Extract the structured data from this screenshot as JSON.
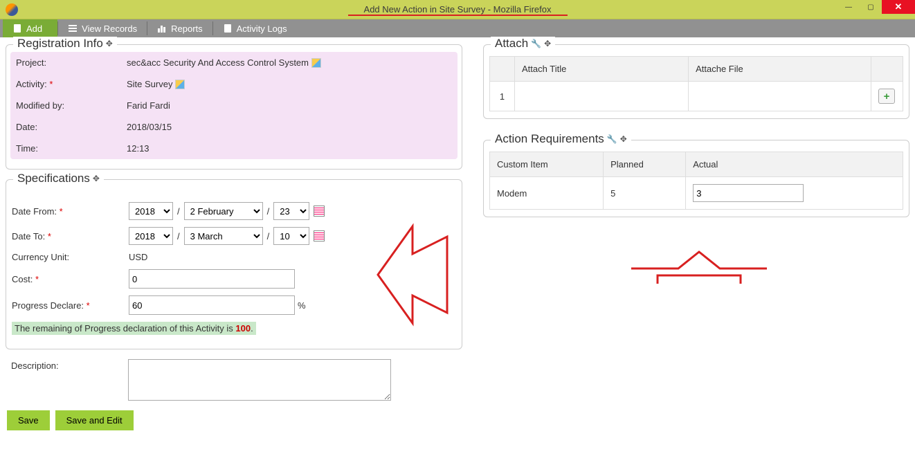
{
  "window": {
    "title": "Add New Action in Site Survey - Mozilla Firefox"
  },
  "toolbar": {
    "add": "Add",
    "view_records": "View Records",
    "reports": "Reports",
    "activity_logs": "Activity Logs"
  },
  "panels": {
    "registration": "Registration Info",
    "specifications": "Specifications",
    "attach": "Attach",
    "requirements": "Action Requirements"
  },
  "registration": {
    "project_label": "Project:",
    "project_value": "sec&acc Security And Access Control System",
    "activity_label": "Activity:",
    "activity_value": "Site Survey",
    "modified_label": "Modified by:",
    "modified_value": "Farid Fardi",
    "date_label": "Date:",
    "date_value": "2018/03/15",
    "time_label": "Time:",
    "time_value": "12:13"
  },
  "spec": {
    "date_from_label": "Date From:",
    "date_to_label": "Date To:",
    "currency_label": "Currency Unit:",
    "currency_value": "USD",
    "cost_label": "Cost:",
    "cost_value": "0",
    "progress_label": "Progress Declare:",
    "progress_value": "60",
    "percent": "%",
    "remaining_pre": "The remaining of Progress declaration of this Activity is",
    "remaining_num": "100",
    "remaining_post": ".",
    "desc_label": "Description:",
    "desc_value": "",
    "sep": "/",
    "from_year": "2018",
    "from_month": "2 February",
    "from_day": "23",
    "to_year": "2018",
    "to_month": "3 March",
    "to_day": "10",
    "req_mark": "*"
  },
  "buttons": {
    "save": "Save",
    "save_edit": "Save and Edit"
  },
  "attach": {
    "col_title": "Attach Title",
    "col_file": "Attache File",
    "row1_idx": "1",
    "add_symbol": "+"
  },
  "req": {
    "col_item": "Custom Item",
    "col_planned": "Planned",
    "col_actual": "Actual",
    "row1_item": "Modem",
    "row1_planned": "5",
    "row1_actual": "3"
  }
}
